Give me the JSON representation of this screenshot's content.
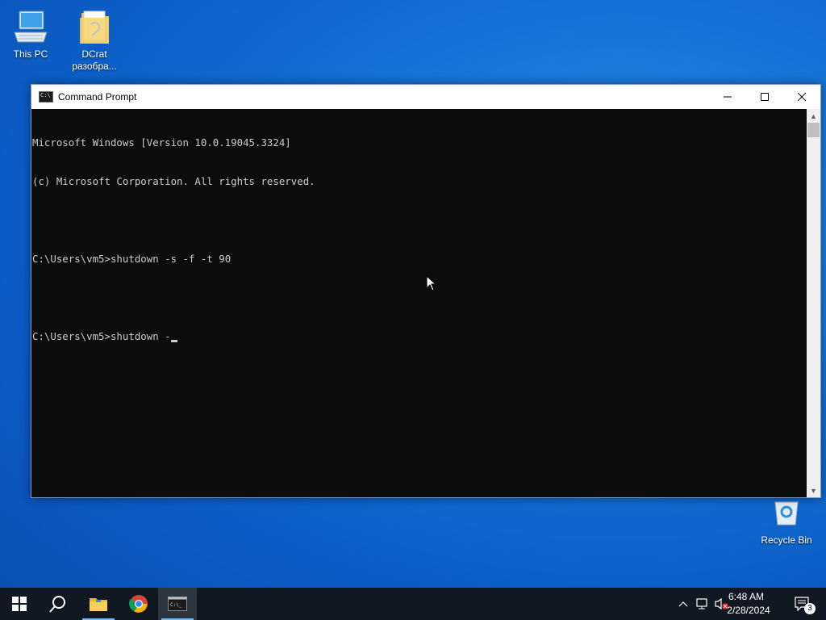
{
  "desktop": {
    "icons": [
      {
        "label": "This PC"
      },
      {
        "label": "DCrat разобра..."
      },
      {
        "label": "Recycle Bin"
      }
    ]
  },
  "window": {
    "title": "Command Prompt",
    "controls": {
      "minimize": "–",
      "maximize": "☐",
      "close": "✕"
    }
  },
  "console": {
    "lines": [
      "Microsoft Windows [Version 10.0.19045.3324]",
      "(c) Microsoft Corporation. All rights reserved.",
      "",
      "C:\\Users\\vm5>shutdown -s -f -t 90",
      "",
      "C:\\Users\\vm5>shutdown -"
    ]
  },
  "taskbar": {
    "apps": [
      "start-icon",
      "search-icon",
      "file-explorer-icon",
      "chrome-icon",
      "command-prompt-icon"
    ],
    "tray": {
      "time": "6:48 AM",
      "date": "2/28/2024",
      "notification_count": "3"
    }
  },
  "colors": {
    "console_bg": "#0c0c0c",
    "console_fg": "#cccccc",
    "taskbar_bg": "#101923",
    "desktop_accent": "#1373d6"
  }
}
